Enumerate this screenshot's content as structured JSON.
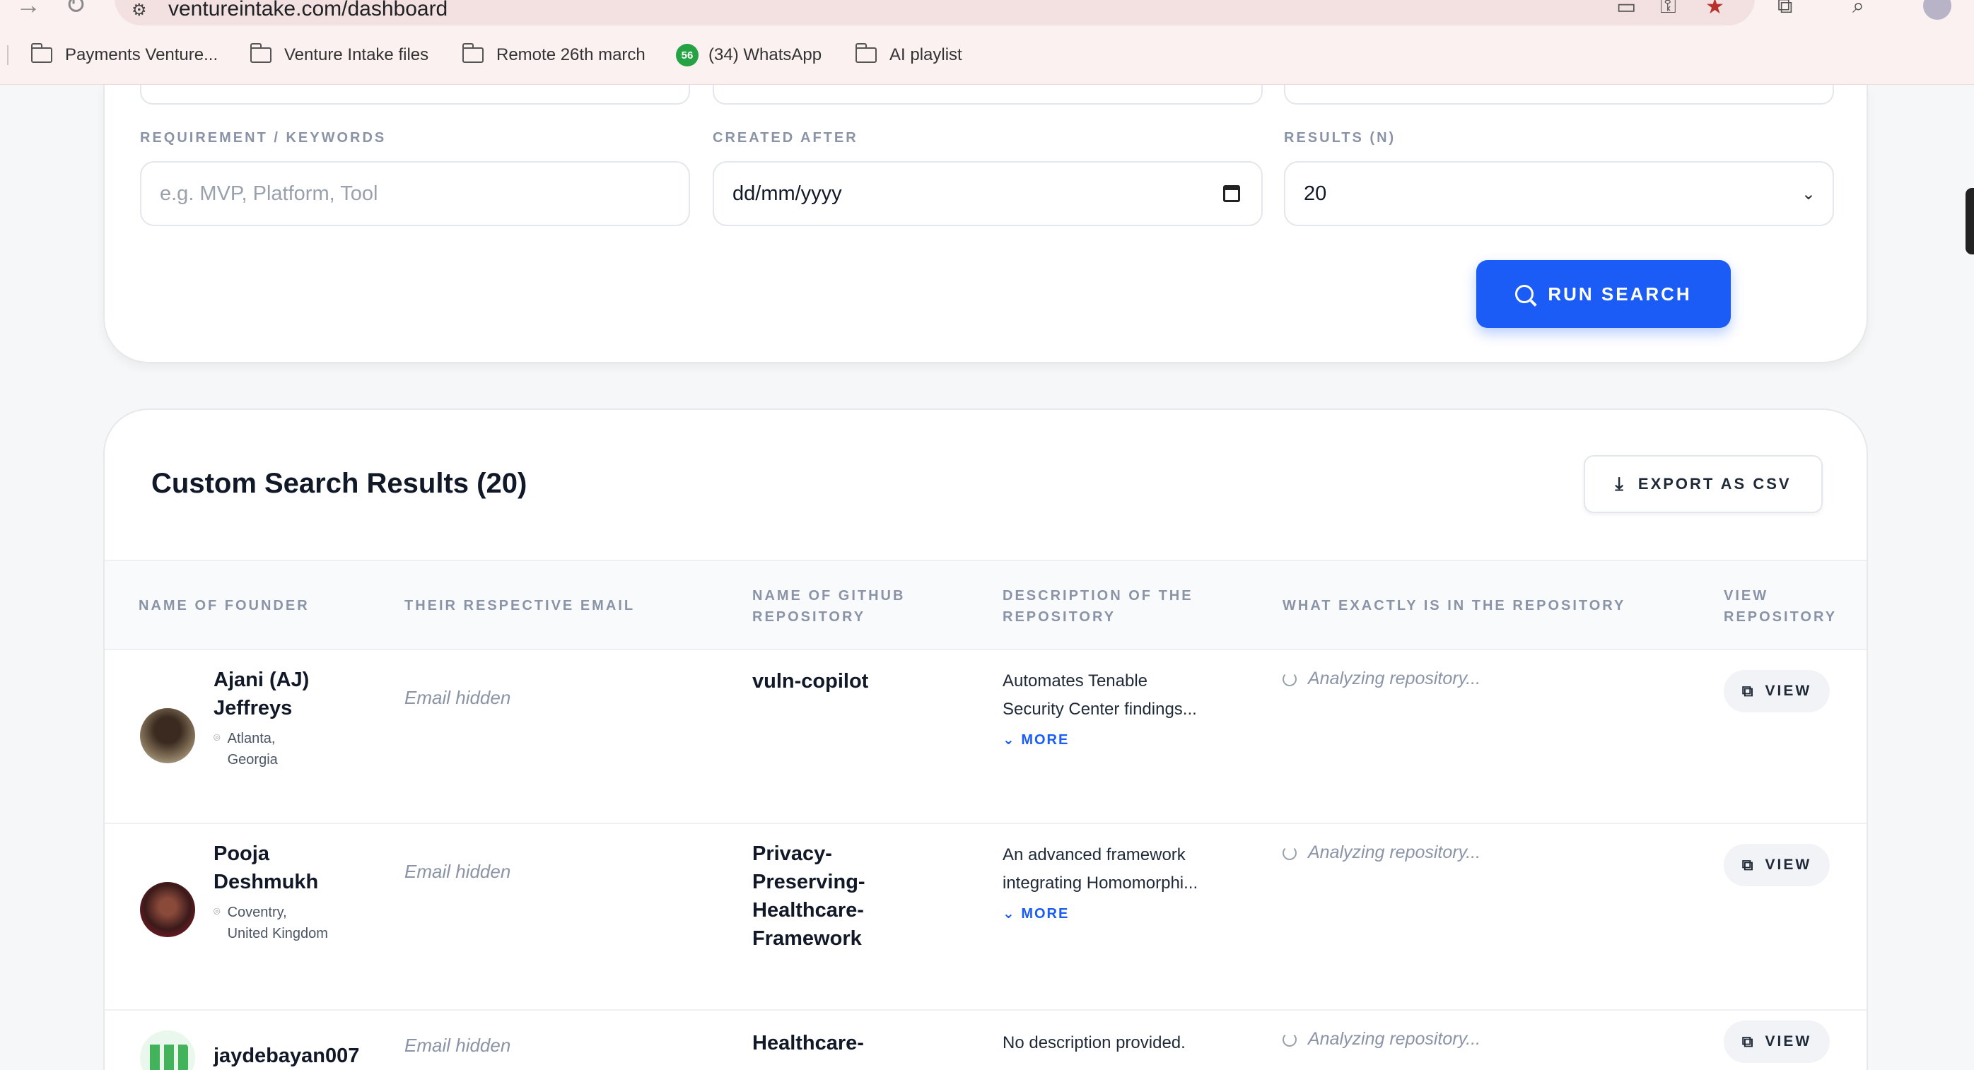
{
  "browser": {
    "url": "ventureintake.com/dashboard",
    "bookmarks": [
      {
        "label": "Payments Venture..."
      },
      {
        "label": "Venture Intake files"
      },
      {
        "label": "Remote 26th march"
      },
      {
        "label": "(34) WhatsApp",
        "badge": "56"
      },
      {
        "label": "AI playlist"
      }
    ]
  },
  "search": {
    "keywords_label": "REQUIREMENT / KEYWORDS",
    "keywords_placeholder": "e.g. MVP, Platform, Tool",
    "created_after_label": "CREATED AFTER",
    "created_after_value": "dd/mm/yyyy",
    "results_label": "RESULTS (N)",
    "results_value": "20",
    "run_label": "RUN SEARCH"
  },
  "results": {
    "title": "Custom Search Results (20)",
    "export_label": "EXPORT AS CSV",
    "columns": {
      "founder": "NAME OF FOUNDER",
      "email": "THEIR RESPECTIVE EMAIL",
      "repo_line1": "NAME OF GITHUB",
      "repo_line2": "REPOSITORY",
      "desc_line1": "DESCRIPTION OF THE",
      "desc_line2": "REPOSITORY",
      "contents": "WHAT EXACTLY IS IN THE REPOSITORY",
      "view_line1": "VIEW",
      "view_line2": "REPOSITORY"
    },
    "rows": [
      {
        "name_line1": "Ajani (AJ)",
        "name_line2": "Jeffreys",
        "loc_line1": "Atlanta,",
        "loc_line2": "Georgia",
        "email": "Email hidden",
        "repo": "vuln-copilot",
        "desc_line1": "Automates Tenable",
        "desc_line2": "Security Center findings...",
        "more": "MORE",
        "status": "Analyzing repository...",
        "view": "VIEW"
      },
      {
        "name_line1": "Pooja",
        "name_line2": "Deshmukh",
        "loc_line1": "Coventry,",
        "loc_line2": "United Kingdom",
        "email": "Email hidden",
        "repo_line1": "Privacy-",
        "repo_line2": "Preserving-",
        "repo_line3": "Healthcare-",
        "repo_line4": "Framework",
        "desc_line1": "An advanced framework",
        "desc_line2": "integrating Homomorphi...",
        "more": "MORE",
        "status": "Analyzing repository...",
        "view": "VIEW"
      },
      {
        "name_line1": "jaydebayan007",
        "email": "Email hidden",
        "repo": "Healthcare-",
        "desc_line1": "No description provided.",
        "status": "Analyzing repository...",
        "view": "VIEW"
      }
    ]
  },
  "colors": {
    "accent": "#1a5cf5",
    "chrome_bg": "#fbf1f0",
    "page_bg": "#f6f7f9"
  }
}
